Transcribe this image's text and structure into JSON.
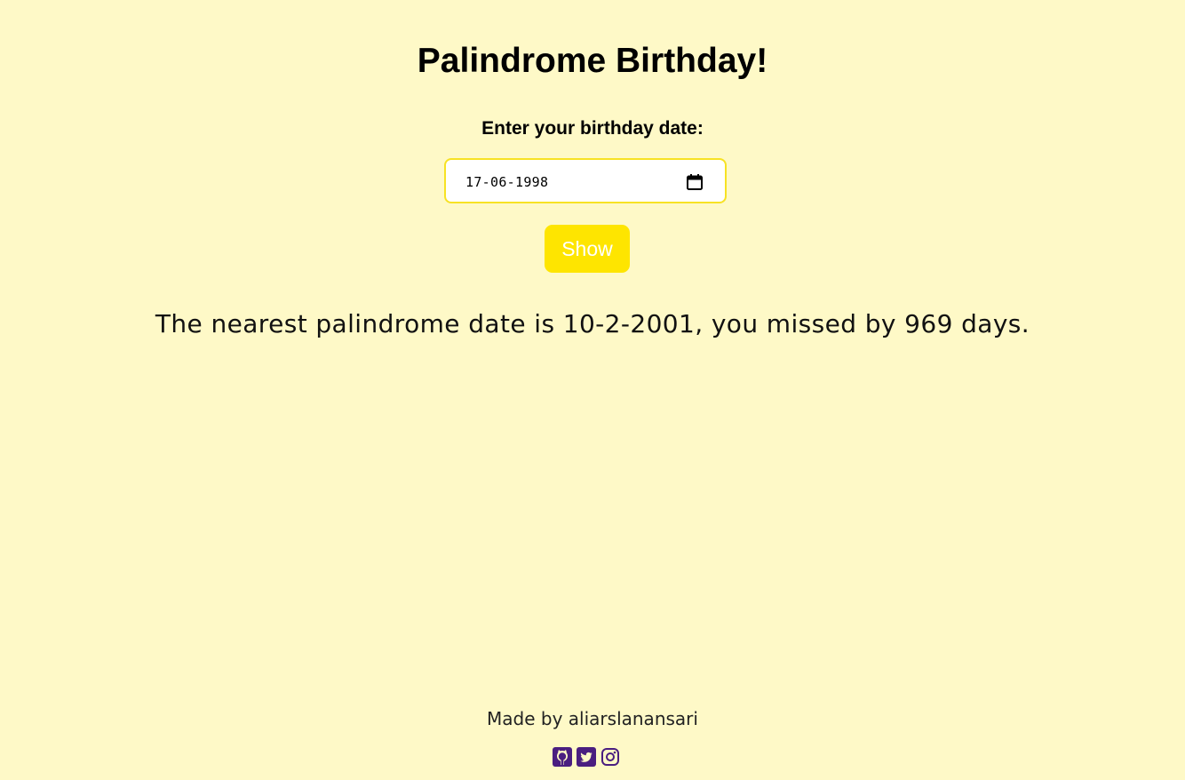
{
  "header": {
    "title": "Palindrome Birthday!"
  },
  "form": {
    "label": "Enter your birthday date:",
    "date_value": "17-06-1998",
    "show_label": "Show"
  },
  "result": {
    "text": "The nearest palindrome date is 10-2-2001, you missed by 969 days."
  },
  "footer": {
    "credit": "Made by aliarslanansari",
    "social": [
      {
        "icon": "github-icon"
      },
      {
        "icon": "twitter-icon"
      },
      {
        "icon": "instagram-icon"
      }
    ]
  },
  "colors": {
    "background": "#fef9c7",
    "accent": "#fee500",
    "input_border": "#f7e224",
    "social_icon": "#4a1e80"
  }
}
